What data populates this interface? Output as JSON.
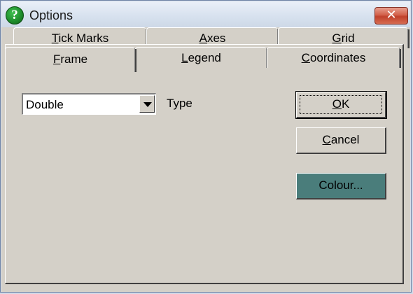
{
  "window": {
    "title": "Options",
    "close_glyph": "✕",
    "help_glyph": "?"
  },
  "tabs_back": [
    {
      "prefix": "",
      "ul": "T",
      "rest": "ick Marks"
    },
    {
      "prefix": "",
      "ul": "A",
      "rest": "xes"
    },
    {
      "prefix": "",
      "ul": "G",
      "rest": "rid"
    }
  ],
  "tabs_front": [
    {
      "prefix": "",
      "ul": "F",
      "rest": "rame",
      "selected": true
    },
    {
      "prefix": "",
      "ul": "L",
      "rest": "egend"
    },
    {
      "prefix": "",
      "ul": "C",
      "rest": "oordinates"
    }
  ],
  "frame": {
    "type_value": "Double",
    "type_label": "Type"
  },
  "buttons": {
    "ok": {
      "ul": "O",
      "rest": "K"
    },
    "cancel": {
      "ul": "C",
      "rest": "ancel"
    },
    "colour": {
      "label": "Colour..."
    }
  },
  "colors": {
    "colour_swatch": "#4a7d7b",
    "close_button": "#c0412b"
  }
}
